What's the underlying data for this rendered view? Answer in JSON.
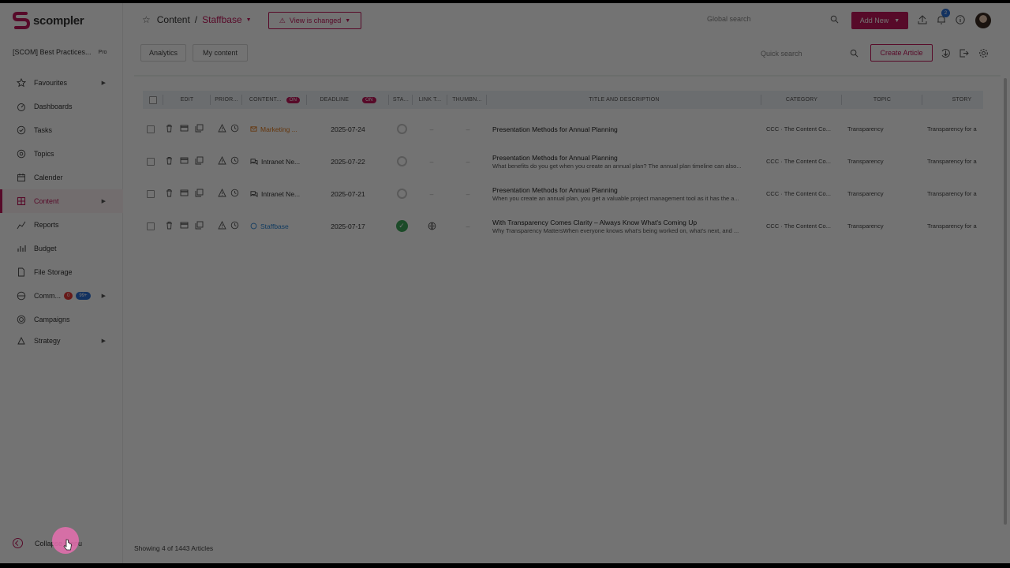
{
  "app": {
    "logo_text": "scompler",
    "brand_color": "#c2185b"
  },
  "workspace": {
    "name": "[SCOM] Best Practices...",
    "badge": "Pro"
  },
  "nav": [
    {
      "label": "Favourites",
      "icon": "star-icon",
      "arrow": true
    },
    {
      "label": "Dashboards",
      "icon": "dashboard-icon",
      "arrow": false
    },
    {
      "label": "Tasks",
      "icon": "tasks-icon",
      "arrow": false
    },
    {
      "label": "Topics",
      "icon": "topics-icon",
      "arrow": false
    },
    {
      "label": "Calender",
      "icon": "calendar-icon",
      "arrow": false
    },
    {
      "label": "Content",
      "icon": "content-icon",
      "arrow": true,
      "active": true
    },
    {
      "label": "Reports",
      "icon": "reports-icon",
      "arrow": false
    },
    {
      "label": "Budget",
      "icon": "budget-icon",
      "arrow": false
    },
    {
      "label": "File Storage",
      "icon": "file-storage-icon",
      "arrow": false
    },
    {
      "label": "Comm...",
      "icon": "community-icon",
      "arrow": true,
      "badge_red": "0",
      "badge_blue": "99+"
    },
    {
      "label": "Campaigns",
      "icon": "campaigns-icon",
      "arrow": false
    },
    {
      "label": "Strategy",
      "icon": "strategy-icon",
      "arrow": true
    }
  ],
  "collapse_label": "Collapse menu",
  "header": {
    "breadcrumb_root": "Content",
    "breadcrumb_sep": "/",
    "breadcrumb_current": "Staffbase",
    "view_changed": "View is changed",
    "global_search_placeholder": "Global search",
    "add_new": "Add New",
    "notification_count": "2"
  },
  "subbar": {
    "tab_analytics": "Analytics",
    "tab_my_content": "My content",
    "quick_search_placeholder": "Quick search",
    "create_article": "Create Article"
  },
  "table": {
    "columns": {
      "edit": "EDIT",
      "priority": "PRIOR...",
      "content": "CONTENT...",
      "content_badge": "ON",
      "deadline": "DEADLINE",
      "deadline_badge": "ON",
      "status": "STA...",
      "link": "LINK T...",
      "thumbnail": "THUMBN...",
      "title": "TITLE AND DESCRIPTION",
      "category": "CATEGORY",
      "topic": "TOPIC",
      "story": "STORY"
    },
    "rows": [
      {
        "channel": "Marketing ...",
        "channel_color": "#e07a1f",
        "deadline": "2025-07-24",
        "status": "open",
        "link": "–",
        "thumbnail": "–",
        "title": "Presentation Methods for Annual Planning",
        "description": "",
        "category": "CCC · The Content Co...",
        "topic": "Transparency",
        "story": "Transparency for a"
      },
      {
        "channel": "Intranet Ne...",
        "channel_color": "#333333",
        "deadline": "2025-07-22",
        "status": "open",
        "link": "–",
        "thumbnail": "–",
        "title": "Presentation Methods for Annual Planning",
        "description": "What benefits do you get when you create an annual plan? The annual plan timeline can also...",
        "category": "CCC · The Content Co...",
        "topic": "Transparency",
        "story": "Transparency for a"
      },
      {
        "channel": "Intranet Ne...",
        "channel_color": "#333333",
        "deadline": "2025-07-21",
        "status": "open",
        "link": "–",
        "thumbnail": "–",
        "title": "Presentation Methods for Annual Planning",
        "description": "When you create an annual plan, you get a valuable project management tool as it has the a...",
        "category": "CCC · The Content Co...",
        "topic": "Transparency",
        "story": "Transparency for a"
      },
      {
        "channel": "Staffbase",
        "channel_color": "#2b86d6",
        "deadline": "2025-07-17",
        "status": "done",
        "link": "globe",
        "thumbnail": "–",
        "title": "With Transparency Comes Clarity – Always Know What's Coming Up",
        "description": "Why Transparency MattersWhen everyone knows what's being worked on, what's next, and ...",
        "category": "CCC · The Content Co...",
        "topic": "Transparency",
        "story": "Transparency for a"
      }
    ]
  },
  "footer": {
    "text": "Showing  4  of  1443 Articles"
  }
}
